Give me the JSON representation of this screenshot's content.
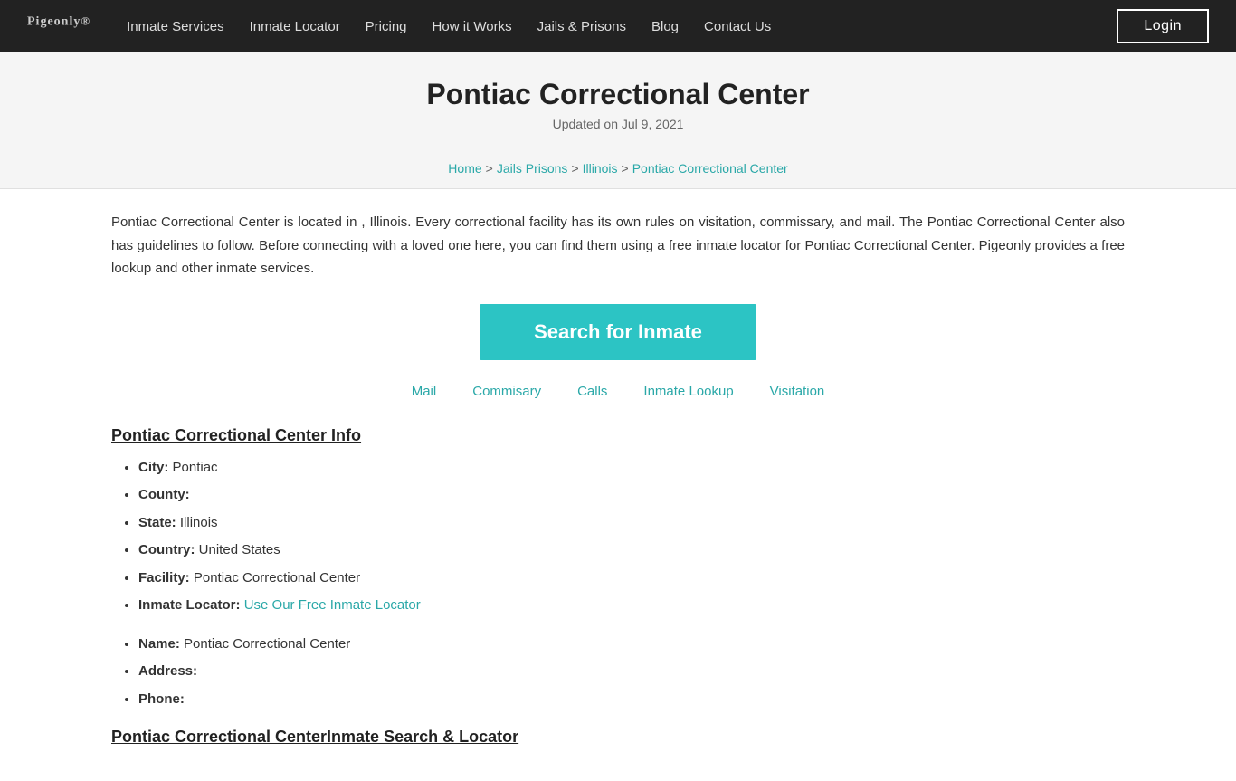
{
  "nav": {
    "logo": "Pigeonly",
    "logo_sup": "®",
    "links": [
      {
        "label": "Inmate Services",
        "href": "#"
      },
      {
        "label": "Inmate Locator",
        "href": "#"
      },
      {
        "label": "Pricing",
        "href": "#"
      },
      {
        "label": "How it Works",
        "href": "#"
      },
      {
        "label": "Jails & Prisons",
        "href": "#"
      },
      {
        "label": "Blog",
        "href": "#"
      },
      {
        "label": "Contact Us",
        "href": "#"
      }
    ],
    "login_label": "Login"
  },
  "header": {
    "title": "Pontiac Correctional Center",
    "updated": "Updated on Jul 9, 2021"
  },
  "breadcrumb": {
    "home": "Home",
    "jails": "Jails Prisons",
    "jails_sep": ">",
    "state": "Illinois",
    "state_sep": ">",
    "current": "Pontiac Correctional Center"
  },
  "description": "Pontiac Correctional Center is located in , Illinois. Every correctional facility has its own rules on visitation, commissary, and mail. The Pontiac Correctional Center also has guidelines to follow. Before connecting with a loved one here, you can find them using a free inmate locator for Pontiac Correctional Center. Pigeonly provides a free lookup and other inmate services.",
  "search_button": "Search for Inmate",
  "tabs": [
    {
      "label": "Mail",
      "href": "#"
    },
    {
      "label": "Commisary",
      "href": "#"
    },
    {
      "label": "Calls",
      "href": "#"
    },
    {
      "label": "Inmate Lookup",
      "href": "#"
    },
    {
      "label": "Visitation",
      "href": "#"
    }
  ],
  "info_section": {
    "title": "Pontiac Correctional Center Info",
    "items": [
      {
        "label": "City:",
        "value": "Pontiac",
        "link": null
      },
      {
        "label": "County:",
        "value": "",
        "link": null
      },
      {
        "label": "State:",
        "value": "Illinois",
        "link": null
      },
      {
        "label": "Country:",
        "value": "United States",
        "link": null
      },
      {
        "label": "Facility:",
        "value": "Pontiac Correctional Center",
        "link": null
      },
      {
        "label": "Inmate Locator:",
        "value": "",
        "link": {
          "text": "Use Our Free Inmate Locator",
          "href": "#"
        }
      }
    ]
  },
  "info_section2": {
    "items": [
      {
        "label": "Name:",
        "value": "Pontiac Correctional Center",
        "link": null
      },
      {
        "label": "Address:",
        "value": "",
        "link": null
      },
      {
        "label": "Phone:",
        "value": "",
        "link": null
      }
    ]
  },
  "section2_title": "Pontiac Correctional CenterInmate Search & Locator"
}
